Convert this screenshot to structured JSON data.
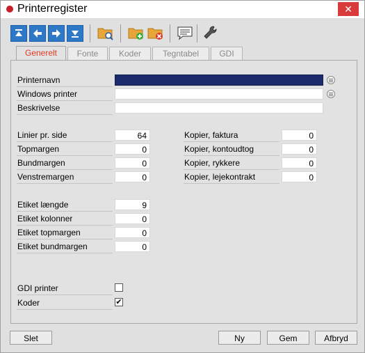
{
  "window": {
    "title": "Printerregister",
    "close_glyph": "✕"
  },
  "toolbar": {
    "icons": [
      "first-record-icon",
      "previous-record-icon",
      "next-record-icon",
      "last-record-icon",
      "search-folder-icon",
      "add-folder-icon",
      "delete-folder-icon",
      "comment-icon",
      "settings-wrench-icon"
    ]
  },
  "tabs": [
    {
      "label": "Generelt",
      "active": true
    },
    {
      "label": "Fonte",
      "active": false
    },
    {
      "label": "Koder",
      "active": false
    },
    {
      "label": "Tegntabel",
      "active": false
    },
    {
      "label": "GDI",
      "active": false
    }
  ],
  "form": {
    "printernavn": {
      "label": "Printernavn",
      "value": ""
    },
    "windows_printer": {
      "label": "Windows printer",
      "value": ""
    },
    "beskrivelse": {
      "label": "Beskrivelse",
      "value": ""
    },
    "left": [
      {
        "label": "Linier pr. side",
        "value": "64"
      },
      {
        "label": "Topmargen",
        "value": "0"
      },
      {
        "label": "Bundmargen",
        "value": "0"
      },
      {
        "label": "Venstremargen",
        "value": "0"
      }
    ],
    "right": [
      {
        "label": "Kopier, faktura",
        "value": "0"
      },
      {
        "label": "Kopier, kontoudtog",
        "value": "0"
      },
      {
        "label": "Kopier, rykkere",
        "value": "0"
      },
      {
        "label": "Kopier, lejekontrakt",
        "value": "0"
      }
    ],
    "etiket": [
      {
        "label": "Etiket længde",
        "value": "9"
      },
      {
        "label": "Etiket kolonner",
        "value": "0"
      },
      {
        "label": "Etiket topmargen",
        "value": "0"
      },
      {
        "label": "Etiket bundmargen",
        "value": "0"
      }
    ],
    "gdi_printer": {
      "label": "GDI printer",
      "checked": false
    },
    "koder": {
      "label": "Koder",
      "checked": true,
      "check_glyph": "✔"
    }
  },
  "buttons": {
    "slet": "Slet",
    "ny": "Ny",
    "gem": "Gem",
    "afbryd": "Afbryd"
  },
  "colors": {
    "selected_field": "#1a2a6b",
    "active_tab_text": "#e03a20",
    "toolbar_blue": "#2e78c8"
  }
}
